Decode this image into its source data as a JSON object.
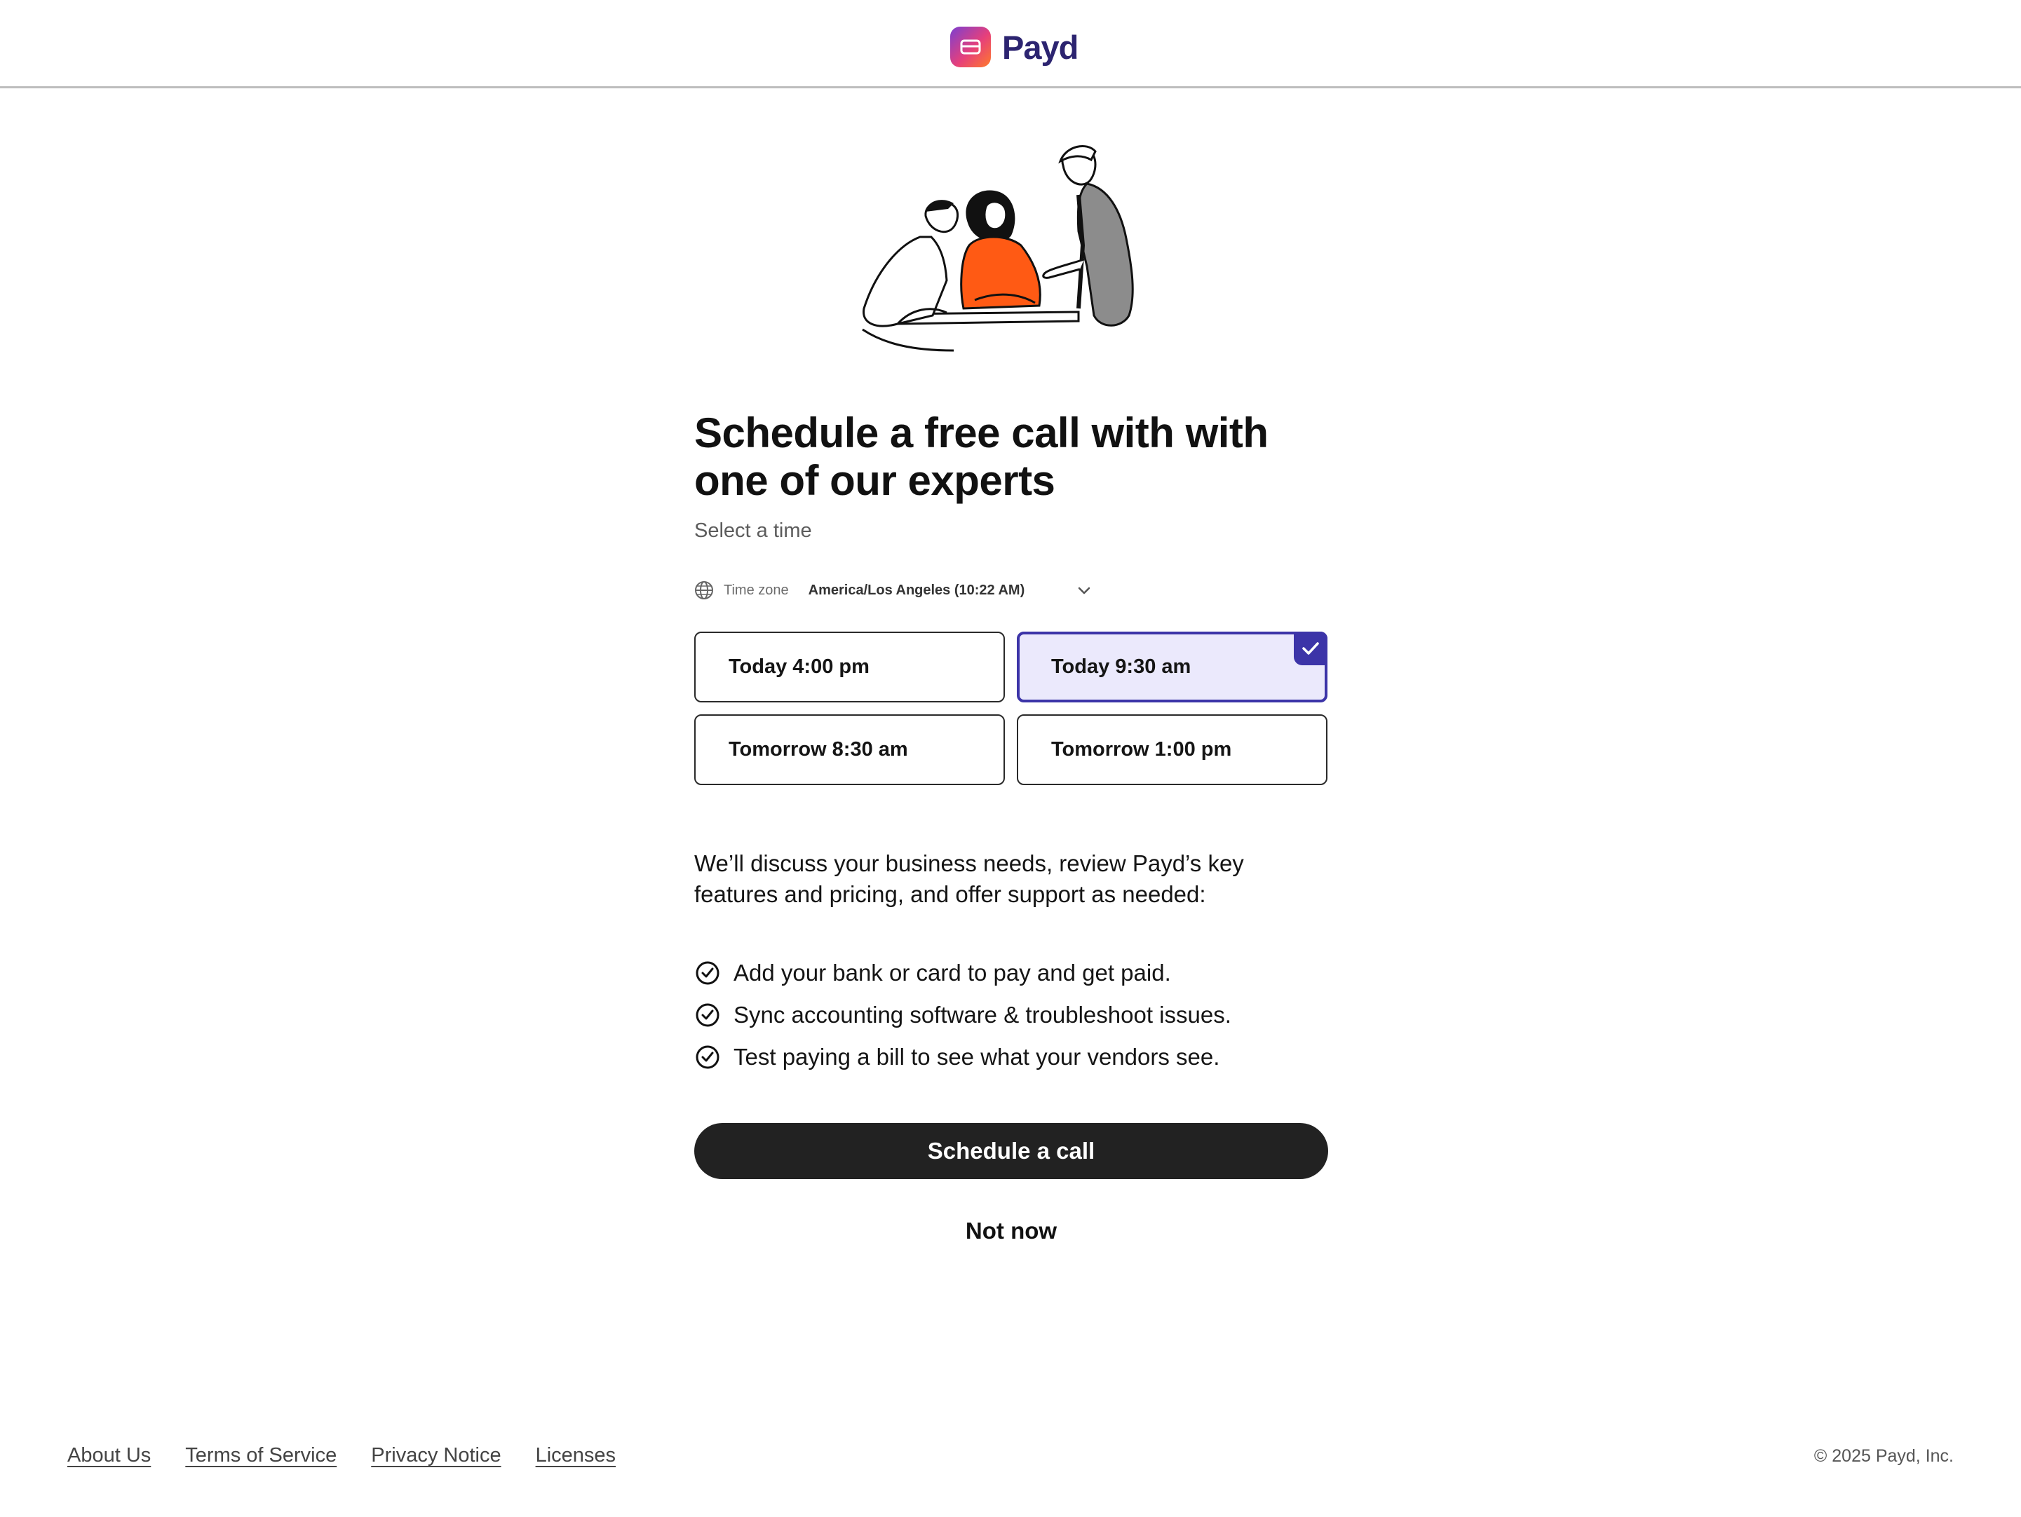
{
  "header": {
    "brand": "Payd",
    "brand_colors": [
      "#7b3fd1",
      "#e6407b",
      "#ff7a2a"
    ],
    "brand_text_color": "#2c2470"
  },
  "hero": {
    "illustration": "three-people-meeting-illustration"
  },
  "main": {
    "title": "Schedule a free call with with one of our experts",
    "subtitle": "Select a time",
    "timezone": {
      "icon": "globe-icon",
      "label": "Time zone",
      "value": "America/Los Angeles (10:22 AM)",
      "dropdown_icon": "chevron-down-icon"
    },
    "slots": [
      {
        "label": "Today 4:00 pm",
        "selected": false
      },
      {
        "label": "Today 9:30 am",
        "selected": true
      },
      {
        "label": "Tomorrow 8:30 am",
        "selected": false
      },
      {
        "label": "Tomorrow 1:00 pm",
        "selected": false
      }
    ],
    "selected_color": "#3c34a8",
    "description": "We’ll discuss your business needs, review Payd’s key features and pricing, and offer support as needed:",
    "benefits": [
      "Add your bank or card to pay and get paid.",
      "Sync accounting software & troubleshoot issues.",
      "Test paying a bill to see what your vendors see."
    ],
    "primary_button": "Schedule a call",
    "secondary_button": "Not now"
  },
  "footer": {
    "links": [
      "About Us",
      "Terms of Service",
      "Privacy Notice",
      "Licenses"
    ],
    "copyright": "© 2025 Payd, Inc."
  }
}
